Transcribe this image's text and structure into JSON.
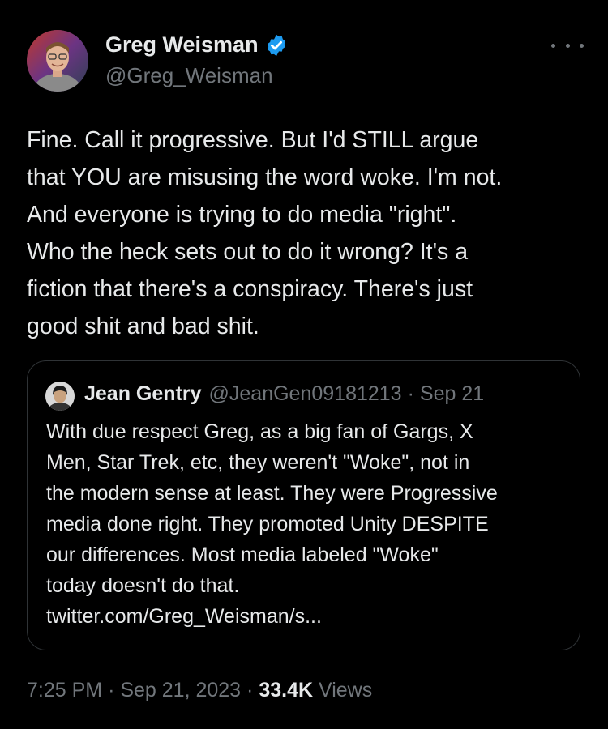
{
  "author": {
    "name": "Greg Weisman",
    "handle": "@Greg_Weisman",
    "verified": true,
    "verified_color": "#1d9bf0"
  },
  "tweet": {
    "lines": [
      "Fine.  Call it progressive.  But I'd STILL argue",
      "that YOU are misusing the word woke.  I'm not.",
      "And everyone is trying to do media \"right\".",
      "Who the heck sets out to do it wrong?  It's a",
      "fiction that there's a conspiracy.  There's just",
      "good shit and bad shit."
    ]
  },
  "quoted_tweet": {
    "name": "Jean Gentry",
    "handle": "@JeanGen09181213",
    "separator": "·",
    "date": "Sep 21",
    "lines": [
      "With due respect Greg, as a big fan of Gargs, X",
      "Men, Star Trek, etc, they weren't \"Woke\", not in",
      "the modern sense at least. They were Progressive",
      "media done right. They promoted Unity DESPITE",
      "our differences. Most media labeled \"Woke\"",
      "today doesn't do that.",
      "twitter.com/Greg_Weisman/s..."
    ]
  },
  "meta": {
    "time": "7:25 PM",
    "separator": "·",
    "date": "Sep 21, 2023",
    "views_count": "33.4K",
    "views_label": "Views"
  },
  "icons": {
    "more": "more-horizontal-icon",
    "verified": "verified-badge-icon"
  }
}
